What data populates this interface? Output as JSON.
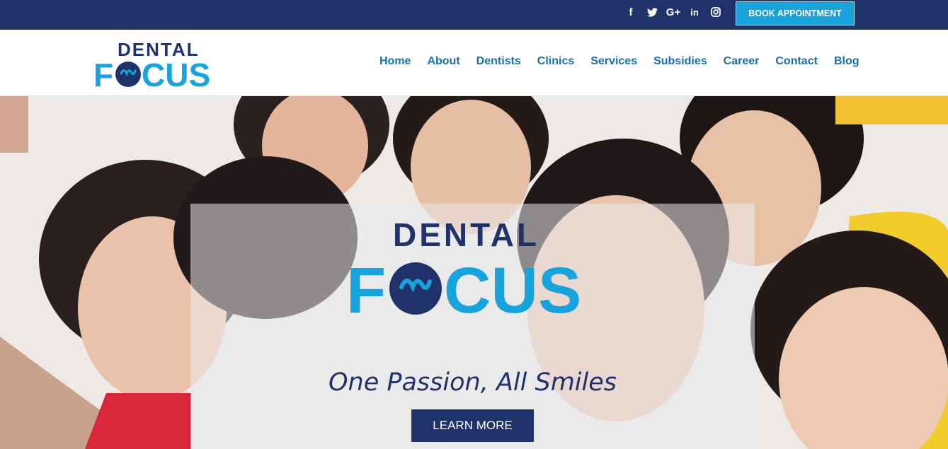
{
  "topbar": {
    "social": [
      {
        "icon": "facebook-icon",
        "glyph": "f"
      },
      {
        "icon": "twitter-icon",
        "glyph": "🐦"
      },
      {
        "icon": "google-plus-icon",
        "glyph": "G+"
      },
      {
        "icon": "linkedin-icon",
        "glyph": "in"
      },
      {
        "icon": "instagram-icon",
        "glyph": "◎"
      }
    ],
    "book_label": "BOOK APPOINTMENT"
  },
  "brand": {
    "line1": "DENTAL",
    "line2_left": "F",
    "line2_right": "CUS",
    "colors": {
      "navy": "#1f336a",
      "cyan": "#19a3dd"
    }
  },
  "nav": [
    "Home",
    "About",
    "Dentists",
    "Clinics",
    "Services",
    "Subsidies",
    "Career",
    "Contact",
    "Blog"
  ],
  "hero": {
    "tagline": "One Passion, All Smiles",
    "cta_label": "LEARN MORE"
  }
}
